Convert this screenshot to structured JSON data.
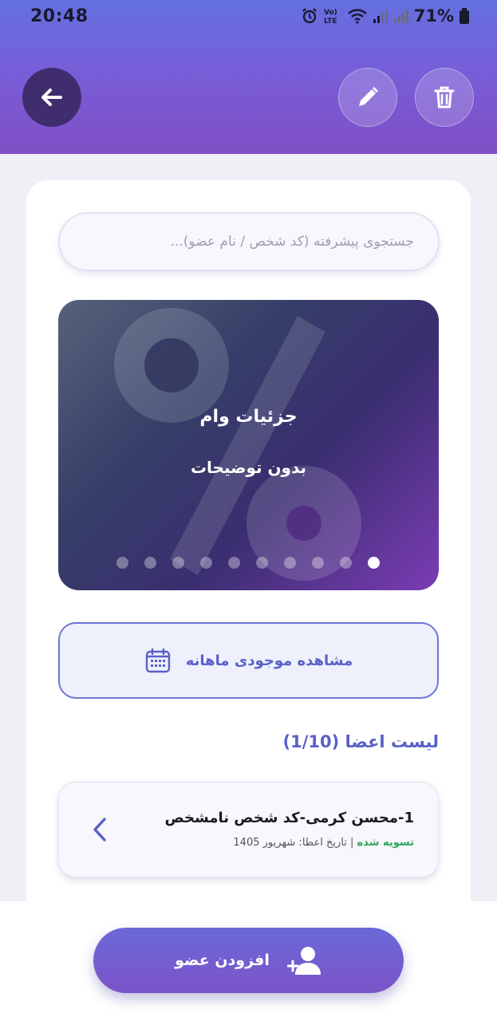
{
  "status_bar": {
    "time": "20:48",
    "battery_text": "71%",
    "icons": [
      "alarm-icon",
      "volte-icon",
      "wifi-icon",
      "signal-icon",
      "signal-icon",
      "battery-icon"
    ]
  },
  "header": {
    "back_icon": "arrow-left-icon",
    "edit_icon": "pencil-icon",
    "delete_icon": "trash-icon",
    "color_top": "#6470e0",
    "color_bottom": "#7e4fc4"
  },
  "search": {
    "placeholder": "جستجوی پیشرفته (کد شخص / نام عضو)..."
  },
  "banner": {
    "title": "جزئیات وام",
    "subtitle": "بدون توضیحات",
    "decor_icon": "percent-icon",
    "slide_count": 10,
    "active_slide": 10
  },
  "monthly_button": {
    "label": "مشاهده موجودی ماهانه",
    "icon": "calendar-icon"
  },
  "members": {
    "title": "لیست اعضا (1/10)",
    "items": [
      {
        "name": "1-محسن کرمی-کد شخص نامشخص",
        "status": "تسویه شده",
        "separator": " | ",
        "date_label": "تاریخ اعطا: شهریور 1405"
      }
    ]
  },
  "add_button": {
    "label": "افزودن عضو",
    "icon": "user-plus-icon"
  },
  "colors": {
    "accent": "#5a60c8",
    "success": "#2fa55a"
  }
}
